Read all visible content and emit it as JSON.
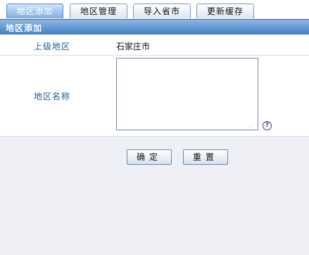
{
  "tabs": [
    {
      "label": "地区添加",
      "active": true
    },
    {
      "label": "地区管理",
      "active": false
    },
    {
      "label": "导入省市",
      "active": false
    },
    {
      "label": "更新缓存",
      "active": false
    }
  ],
  "section_title": "地区添加",
  "form": {
    "parent_label": "上级地区",
    "parent_value": "石家庄市",
    "name_label": "地区名称",
    "name_value": "",
    "help_icon": "question-mark"
  },
  "buttons": {
    "submit_label": "确定",
    "reset_label": "重置"
  },
  "colors": {
    "active_tab": "#7eaee0",
    "titlebar": "#3f7fc5",
    "label_text": "#1e5aa0",
    "page_bg": "#eef0f6"
  }
}
